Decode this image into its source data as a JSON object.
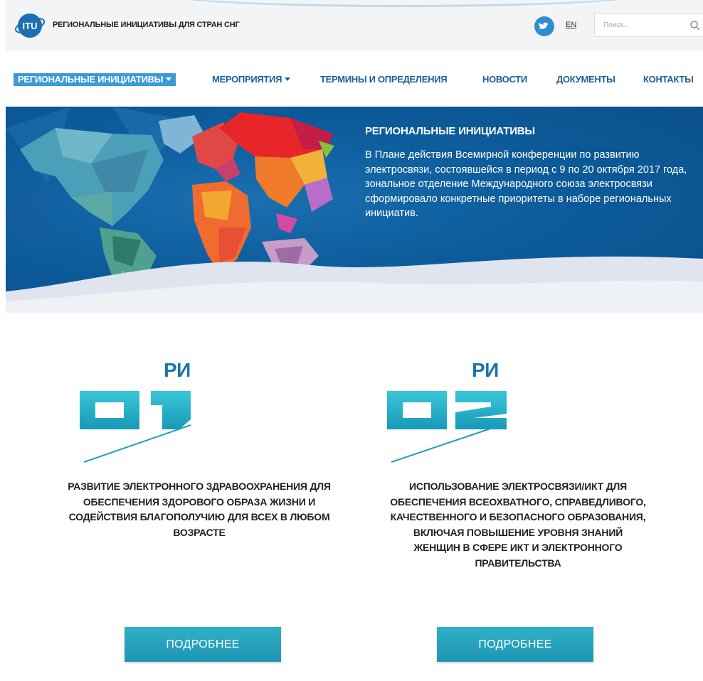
{
  "header": {
    "site_title": "РЕГИОНАЛЬНЫЕ ИНИЦИАТИВЫ ДЛЯ СТРАН СНГ",
    "logo_text": "ITU",
    "lang_link": "EN",
    "search_placeholder": "Поиск..."
  },
  "nav": {
    "items": [
      {
        "label": "РЕГИОНАЛЬНЫЕ ИНИЦИАТИВЫ",
        "dropdown": true,
        "active": true
      },
      {
        "label": "МЕРОПРИЯТИЯ",
        "dropdown": true,
        "active": false
      },
      {
        "label": "ТЕРМИНЫ И ОПРЕДЕЛЕНИЯ",
        "dropdown": false,
        "active": false
      },
      {
        "label": "НОВОСТИ",
        "dropdown": false,
        "active": false
      },
      {
        "label": "ДОКУМЕНТЫ",
        "dropdown": false,
        "active": false
      },
      {
        "label": "КОНТАКТЫ",
        "dropdown": false,
        "active": false
      }
    ]
  },
  "hero": {
    "title": "РЕГИОНАЛЬНЫЕ ИНИЦИАТИВЫ",
    "text": "В Плане действия Всемирной конференции по развитию электросвязи, состоявшейся в период с 9 по 20 октября 2017 года, зональное отделение Международного союза электросвязи сформировало конкретные приоритеты в наборе региональных инициатив."
  },
  "initiatives": [
    {
      "label": "РИ",
      "number": "01",
      "text": "РАЗВИТИЕ ЭЛЕКТРОННОГО ЗДРАВООХРАНЕНИЯ ДЛЯ ОБЕСПЕЧЕНИЯ ЗДОРОВОГО ОБРАЗА ЖИЗНИ И СОДЕЙСТВИЯ БЛАГОПОЛУЧИЮ ДЛЯ ВСЕХ В ЛЮБОМ ВОЗРАСТЕ",
      "button": "ПОДРОБНЕЕ"
    },
    {
      "label": "РИ",
      "number": "02",
      "text": "ИСПОЛЬЗОВАНИЕ ЭЛЕКТРОСВЯЗИ/ИКТ ДЛЯ ОБЕСПЕЧЕНИЯ ВСЕОХВАТНОГО, СПРАВЕДЛИВОГО, КАЧЕСТВЕННОГО И БЕЗОПАСНОГО ОБРАЗОВАНИЯ, ВКЛЮЧАЯ ПОВЫШЕНИЕ УРОВНЯ ЗНАНИЙ ЖЕНЩИН В СФЕРЕ ИКТ И ЭЛЕКТРОННОГО ПРАВИТЕЛЬСТВА",
      "button": "ПОДРОБНЕЕ"
    }
  ],
  "colors": {
    "brand_blue": "#1b73ae",
    "nav_active_bg": "#3a9bd5",
    "nav_text": "#1d5f9a",
    "hero_bg": "#0d5c9c",
    "button_teal": "#2aa7c0",
    "twitter_blue": "#2d8fd0"
  },
  "icons": {
    "logo": "itu-logo-icon",
    "twitter": "twitter-icon",
    "search": "search-icon",
    "dropdown": "caret-down-icon"
  }
}
